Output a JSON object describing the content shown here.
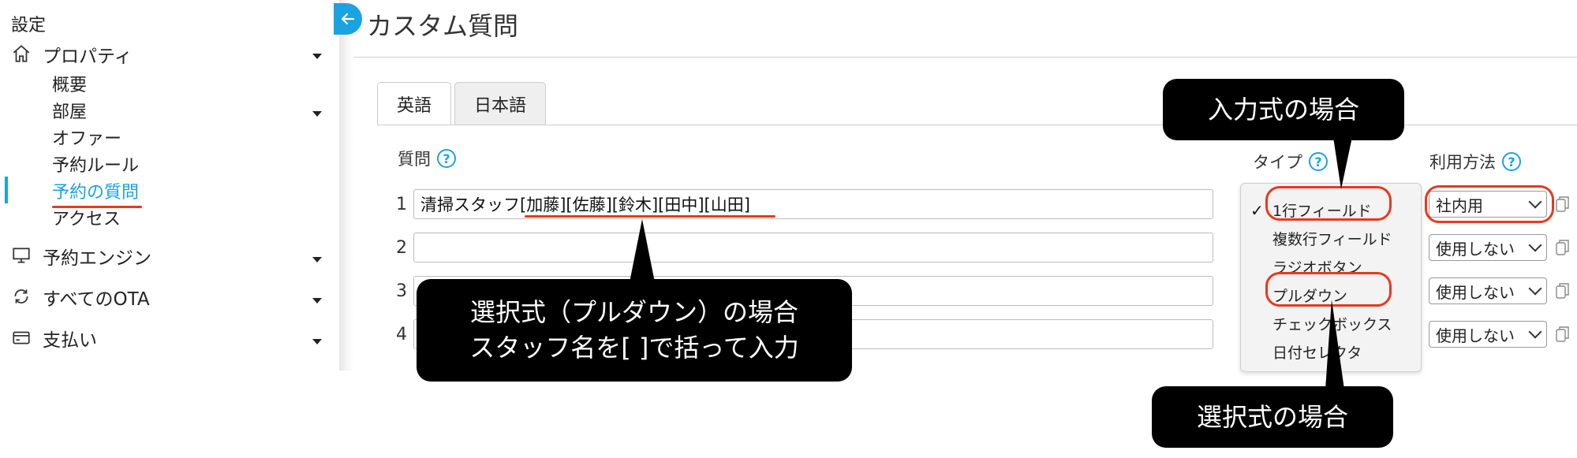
{
  "sidebar": {
    "heading": "設定",
    "groups": [
      {
        "label": "プロパティ",
        "icon": "home-icon"
      },
      {
        "label": "予約エンジン",
        "icon": "monitor-icon"
      },
      {
        "label": "すべてのOTA",
        "icon": "sync-icon"
      },
      {
        "label": "支払い",
        "icon": "credit-card-icon"
      }
    ],
    "sub_items": [
      "概要",
      "部屋",
      "オファー",
      "予約ルール",
      "予約の質問",
      "アクセス"
    ],
    "active_item": "予約の質問"
  },
  "page": {
    "title": "カスタム質問",
    "back_icon": "arrow-left-icon"
  },
  "tabs": [
    {
      "label": "英語",
      "active": true
    },
    {
      "label": "日本語",
      "active": false
    }
  ],
  "columns": {
    "question": "質問",
    "type": "タイプ",
    "usage": "利用方法",
    "help": "?"
  },
  "rows": [
    {
      "num": "1",
      "value": "清掃スタッフ[加藤][佐藤][鈴木][田中][山田]",
      "usage": "社内用"
    },
    {
      "num": "2",
      "value": "",
      "usage": "使用しない"
    },
    {
      "num": "3",
      "value": "",
      "usage": "使用しない"
    },
    {
      "num": "4",
      "value": "",
      "usage": "使用しない"
    }
  ],
  "type_dropdown": {
    "selected": "1行フィールド",
    "check": "✓",
    "options": [
      "1行フィールド",
      "複数行フィールド",
      "ラジオボタン",
      "プルダウン",
      "チェックボックス",
      "日付セレクタ"
    ]
  },
  "callouts": {
    "input_type": "入力式の場合",
    "select_type": "選択式の場合",
    "pulldown_line1": "選択式（プルダウン）の場合",
    "pulldown_line2": "スタッフ名を[ ]で括って入力"
  },
  "colors": {
    "accent": "#1aa3e0",
    "highlight": "#e8391e",
    "callout_bg": "#000000"
  }
}
